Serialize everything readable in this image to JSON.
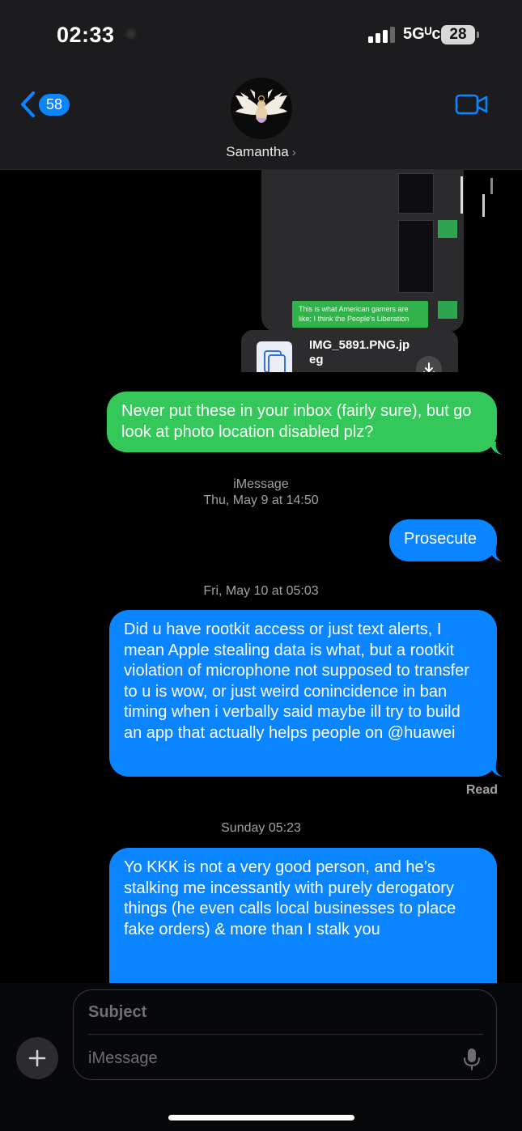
{
  "status_bar": {
    "time": "02:33",
    "network": "5Gᵁc",
    "battery": "28"
  },
  "nav": {
    "back_count": "58",
    "contact_name": "Samantha",
    "contact_chevron": "›"
  },
  "shared_image": {
    "caption": "This is what American gamers are like; I think the People's Liberation",
    "file_name": "IMG_5891.PNG.jpeg"
  },
  "messages": [
    {
      "type": "sent",
      "color": "green",
      "text": "Never put these in your inbox (fairly sure), but go look at photo location disabled plz?"
    },
    {
      "type": "timestamp",
      "service": "iMessage",
      "text": "Thu, May 9 at 14:50"
    },
    {
      "type": "sent",
      "color": "blue",
      "text": "Prosecute"
    },
    {
      "type": "timestamp",
      "text": "Fri, May 10 at 05:03"
    },
    {
      "type": "sent",
      "color": "blue",
      "text": "Did u have rootkit access or just text alerts, I mean Apple stealing data is what, but a rootkit violation of microphone not supposed to transfer to u is wow, or just weird conincidence in ban timing when i verbally said maybe ill try to build an app that actually helps people on @huawei"
    },
    {
      "type": "receipt",
      "text": "Read"
    },
    {
      "type": "timestamp",
      "text": "Sunday 05:23"
    },
    {
      "type": "sent",
      "color": "blue",
      "text": "Yo KKK is not a very good person, and he’s stalking me incessantly with purely derogatory things (he even calls local businesses to place fake orders) & more than I stalk you"
    }
  ],
  "compose": {
    "subject_placeholder": "Subject",
    "message_placeholder": "iMessage"
  },
  "colors": {
    "imessage_blue": "#0a84ff",
    "sms_green": "#34c759",
    "background": "#000000",
    "header": "#1c1c1e"
  }
}
